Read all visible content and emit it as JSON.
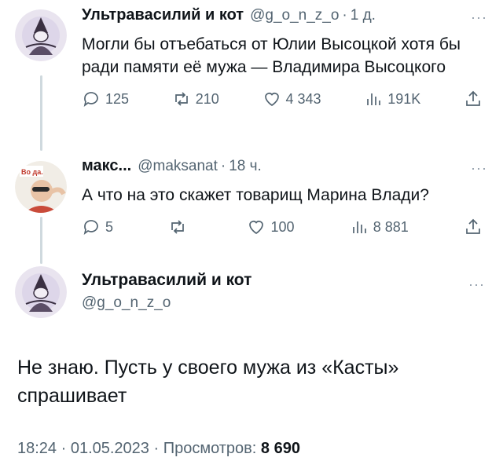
{
  "tweets": [
    {
      "author": "Ультравасилий и кот",
      "handle": "@g_o_n_z_o",
      "dot": "·",
      "time": "1 д.",
      "text": "Могли бы отъебаться от Юлии Высоцкой хотя бы ради памяти её мужа — Владимира Высоцкого",
      "replies": "125",
      "retweets": "210",
      "likes": "4 343",
      "views": "191K"
    },
    {
      "author": "макс...",
      "handle": "@maksanat",
      "dot": "·",
      "time": "18 ч.",
      "text": "А что на это скажет товарищ Марина Влади?",
      "replies": "5",
      "retweets": "",
      "likes": "100",
      "views": "8 881"
    }
  ],
  "main": {
    "author": "Ультравасилий и кот",
    "handle": "@g_o_n_z_o",
    "text": "Не знаю. Пусть у своего мужа из «Касты» спрашивает",
    "timestamp": "18:24 · 01.05.2023 · Просмотров:",
    "views": "8 690"
  },
  "more_label": "···",
  "icons": [
    "reply-icon",
    "retweet-icon",
    "like-icon",
    "views-icon",
    "share-icon"
  ]
}
